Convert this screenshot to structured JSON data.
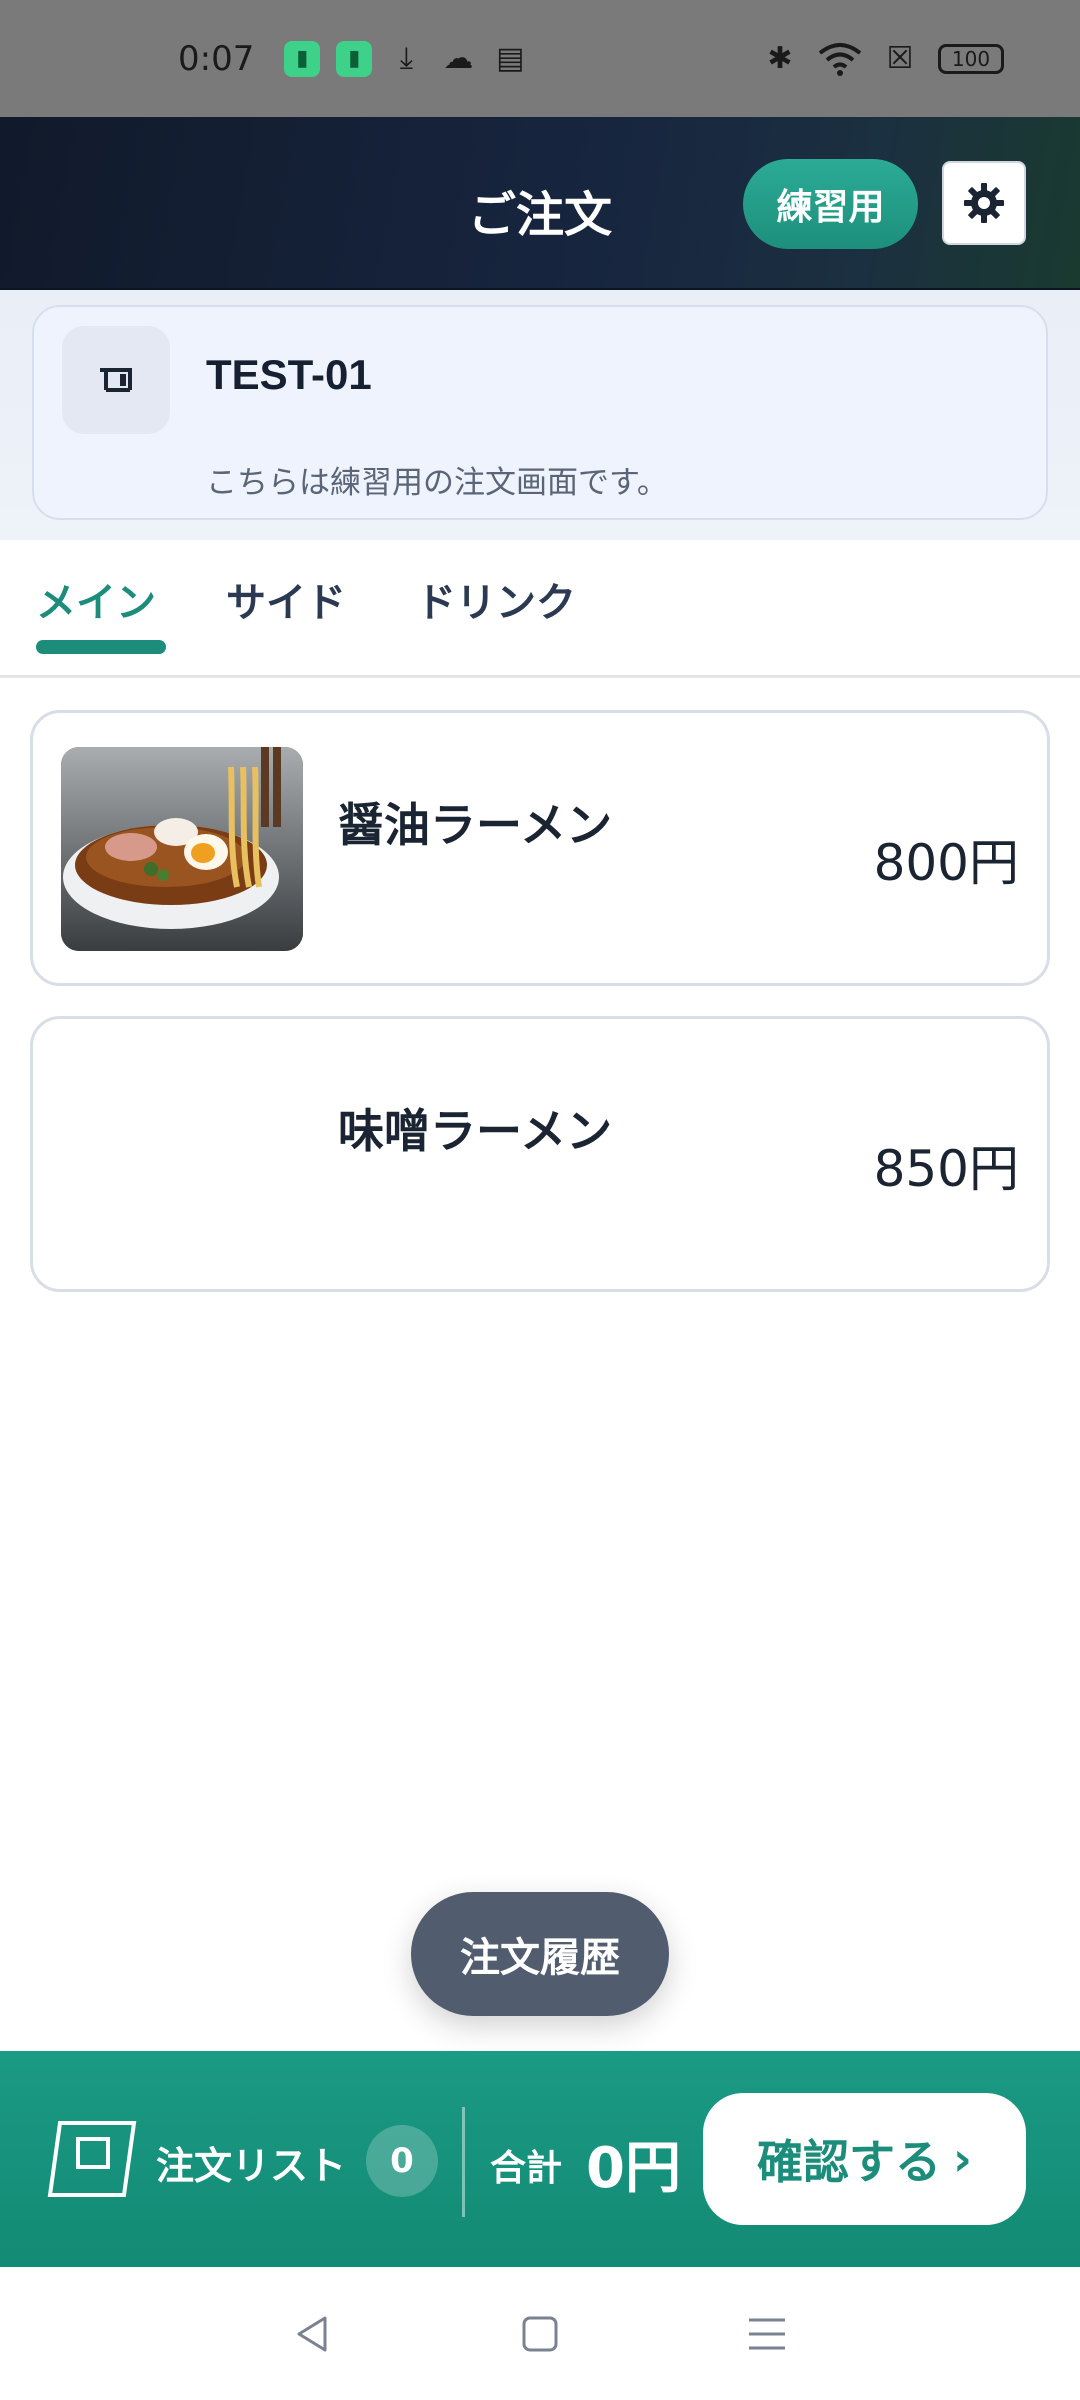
{
  "status_bar": {
    "time": "0:07",
    "battery": "100"
  },
  "header": {
    "title": "ご注文",
    "practice_badge": "練習用"
  },
  "info": {
    "table_id": "TEST-01",
    "note": "こちらは練習用の注文画面です。"
  },
  "tabs": [
    {
      "label": "メイン",
      "active": true
    },
    {
      "label": "サイド",
      "active": false
    },
    {
      "label": "ドリンク",
      "active": false
    }
  ],
  "menu_items": [
    {
      "name": "醤油ラーメン",
      "price": "800円",
      "has_photo": true
    },
    {
      "name": "味噌ラーメン",
      "price": "850円",
      "has_photo": false
    }
  ],
  "history_button": "注文履歴",
  "order_bar": {
    "order_list_label": "注文リスト",
    "count": "0",
    "total_label": "合計",
    "total_value": "0円",
    "confirm_label": "確認する",
    "confirm_chevron": "›"
  },
  "colors": {
    "accent": "#1b8d7a",
    "header_bg": "#111a2b",
    "history_bg": "#515c6e"
  }
}
